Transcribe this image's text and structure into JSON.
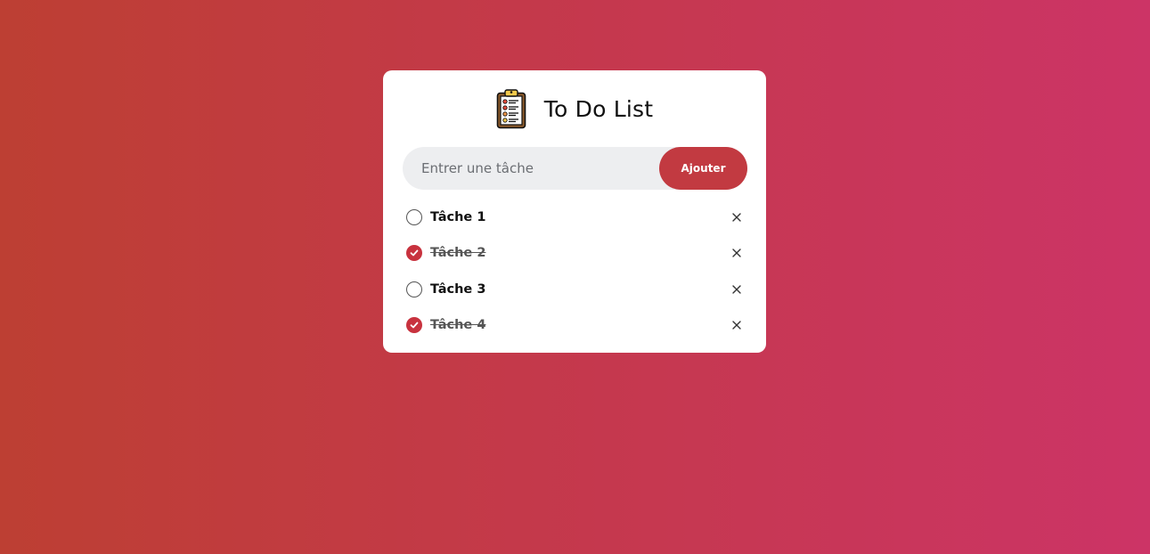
{
  "app": {
    "title": "To Do List",
    "icon": "clipboard-icon"
  },
  "input": {
    "placeholder": "Entrer une tâche",
    "value": ""
  },
  "add_button": {
    "label": "Ajouter"
  },
  "tasks": [
    {
      "label": "Tâche 1",
      "done": false
    },
    {
      "label": "Tâche 2",
      "done": true
    },
    {
      "label": "Tâche 3",
      "done": false
    },
    {
      "label": "Tâche 4",
      "done": true
    }
  ],
  "colors": {
    "accent": "#c23a41",
    "check": "#c8323e",
    "gradient_start": "#bd3f33",
    "gradient_end": "#cc3466",
    "card": "#ffffff",
    "input_bg": "#edeef0"
  }
}
